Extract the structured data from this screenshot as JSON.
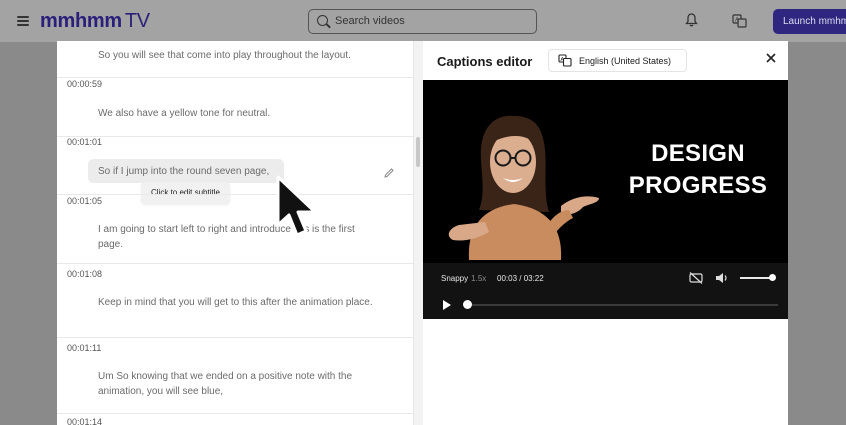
{
  "topbar": {
    "logo_main": "mmhmm",
    "logo_suffix": "TV",
    "search_placeholder": "Search videos",
    "launch_label": "Launch mmhmm"
  },
  "captions": {
    "cues": [
      {
        "text": "So you will see that come into play throughout the layout."
      },
      {
        "time": "00:00:59",
        "text": "We also have a yellow tone for neutral."
      },
      {
        "time": "00:01:01",
        "text": "So if I jump into the round seven page,"
      },
      {
        "time": "00:01:05",
        "text": "I am going to start left to right and introduce this is the first page."
      },
      {
        "time": "00:01:08",
        "text": "Keep in mind that you will get to this after the animation place."
      },
      {
        "time": "00:01:11",
        "text": "Um So knowing that we ended on a positive note with the animation, you will see blue,"
      },
      {
        "time": "00:01:14",
        "text": ""
      }
    ],
    "tooltip": "Click to edit subtitle"
  },
  "editor": {
    "title": "Captions editor",
    "language": "English (United States)"
  },
  "video": {
    "headline_line1": "DESIGN",
    "headline_line2": "PROGRESS",
    "speed_label": "Snappy",
    "speed_value": "1.5x",
    "time": "00:03 / 03:22",
    "progress": 0.01,
    "volume": 0.9
  },
  "colors": {
    "brand": "#2f2680",
    "video_bg": "#000000"
  }
}
